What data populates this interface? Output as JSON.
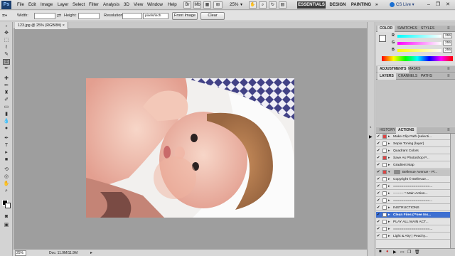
{
  "app": {
    "logo": "Ps"
  },
  "menu": [
    "File",
    "Edit",
    "Image",
    "Layer",
    "Select",
    "Filter",
    "Analysis",
    "3D",
    "View",
    "Window",
    "Help"
  ],
  "menubar": {
    "zoom": "25%",
    "workspaces": [
      "ESSENTIALS",
      "DESIGN",
      "PAINTING"
    ],
    "more": "»",
    "cslive": "CS Live"
  },
  "options": {
    "width_label": "Width:",
    "height_label": "Height:",
    "resolution_label": "Resolution:",
    "resolution_unit": "pixels/inch",
    "front_image": "Front Image",
    "clear": "Clear"
  },
  "document": {
    "tab": "123.jpg @ 25% (RGB/8#)",
    "zoom": "25%",
    "info": "Doc: 11.9M/11.9M"
  },
  "color_panel": {
    "tabs": [
      "COLOR",
      "SWATCHES",
      "STYLES"
    ],
    "r_label": "R",
    "g_label": "G",
    "b_label": "B",
    "r": "255",
    "g": "255",
    "b": "255"
  },
  "adjust_panel": {
    "tabs": [
      "ADJUSTMENTS",
      "MASKS"
    ]
  },
  "layers_panel": {
    "tabs": [
      "LAYERS",
      "CHANNELS",
      "PATHS"
    ]
  },
  "actions_panel": {
    "tabs": [
      "HISTORY",
      "ACTIONS"
    ],
    "items": [
      {
        "label": "Make Clip Path (selecti...",
        "type": "action",
        "dlg": true
      },
      {
        "label": "Sepia Toning (layer)",
        "type": "action",
        "dlg": false
      },
      {
        "label": "Quadrant Colors",
        "type": "action",
        "dlg": false
      },
      {
        "label": "Save As Photoshop P...",
        "type": "action",
        "dlg": true
      },
      {
        "label": "Gradient Map",
        "type": "action",
        "dlg": false
      },
      {
        "label": "Bellevue Avenue - Pl...",
        "type": "set",
        "dlg": true
      },
      {
        "label": "Copyright © Bellevue...",
        "type": "action",
        "dlg": false
      },
      {
        "label": "==================...",
        "type": "action",
        "dlg": false
      },
      {
        "label": "--------- * Main Action...",
        "type": "action",
        "dlg": false
      },
      {
        "label": "==================...",
        "type": "action",
        "dlg": false
      },
      {
        "label": "INSTRUCTIONS",
        "type": "action",
        "dlg": false
      },
      {
        "label": "Clean Files (**see Ins...",
        "type": "selected",
        "dlg": true
      },
      {
        "label": "PLAY ALL MAIN ACT...",
        "type": "action",
        "dlg": false
      },
      {
        "label": "==================...",
        "type": "action",
        "dlg": false
      },
      {
        "label": "Light & Airy | Peachy...",
        "type": "action",
        "dlg": false
      }
    ]
  },
  "colors": {
    "workspace": "#a9a9a9",
    "accent": "#3d6fd1",
    "dark_button": "#3c3c3c"
  }
}
